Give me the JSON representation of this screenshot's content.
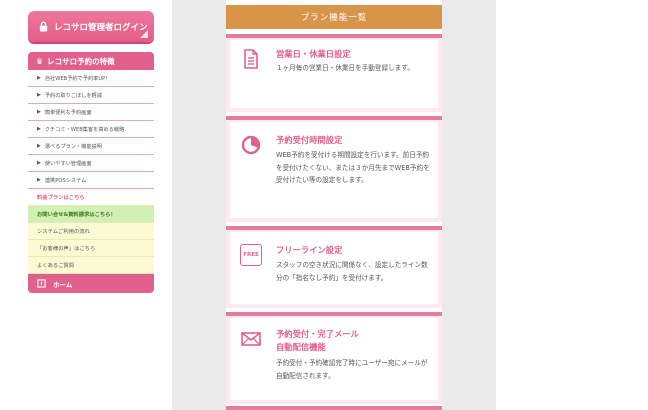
{
  "sidebar": {
    "login_label": "レコサロ管理者ログイン",
    "feature_header": "レコサロ予約の特徴",
    "nav_items": [
      {
        "label": "自社WEB予約で予約率UP！"
      },
      {
        "label": "予約の取りこぼしを軽減"
      },
      {
        "label": "簡単便利な予約画面"
      },
      {
        "label": "クチコミ・WEB集客を高める戦略"
      },
      {
        "label": "選べるプラン・機能説明"
      },
      {
        "label": "使いやすい管理画面"
      },
      {
        "label": "連携POSシステム"
      }
    ],
    "extra_items": [
      {
        "label": "料金プランはこちら",
        "style": "pink"
      },
      {
        "label": "お問い合せ&資料請求はこちら！",
        "style": "green"
      },
      {
        "label": "システムご利用の流れ",
        "style": "yellow"
      },
      {
        "label": "「お客様の声」はこちら",
        "style": "yellow"
      },
      {
        "label": "よくあるご質問",
        "style": "yellow"
      }
    ],
    "home_label": "ホーム"
  },
  "main": {
    "header": "プラン機能一覧",
    "cards": [
      {
        "icon": "document-icon",
        "title": "営業日・休業日設定",
        "desc": "１ヶ月毎の営業日・休業日を手動登録します。"
      },
      {
        "icon": "pie-chart-icon",
        "title": "予約受付時間設定",
        "desc": "WEB予約を受付ける期間設定を行います。前日予約を受付けたくない、または３か月先までWEB予約を受付けたい等の設定をします。"
      },
      {
        "icon": "free-badge-icon",
        "badge_text": "FREE",
        "title": "フリーライン設定",
        "desc": "スタッフの空き状況に関係なく、設定したライン数分の「指名なし予約」を受付けます。"
      },
      {
        "icon": "mail-icon",
        "title": "予約受付・完了メール自動配信機能",
        "title_lines": [
          "予約受付・完了メール",
          "自動配信機能"
        ],
        "desc": "予約受付・予約確認完了時にユーザー宛にメールが自動配信されます。"
      }
    ]
  },
  "colors": {
    "accent_pink": "#e2618c",
    "header_orange": "#d8954a",
    "card_bg": "#fde9ef",
    "green_item": "#d2efb4",
    "yellow_item": "#fbfad2"
  }
}
